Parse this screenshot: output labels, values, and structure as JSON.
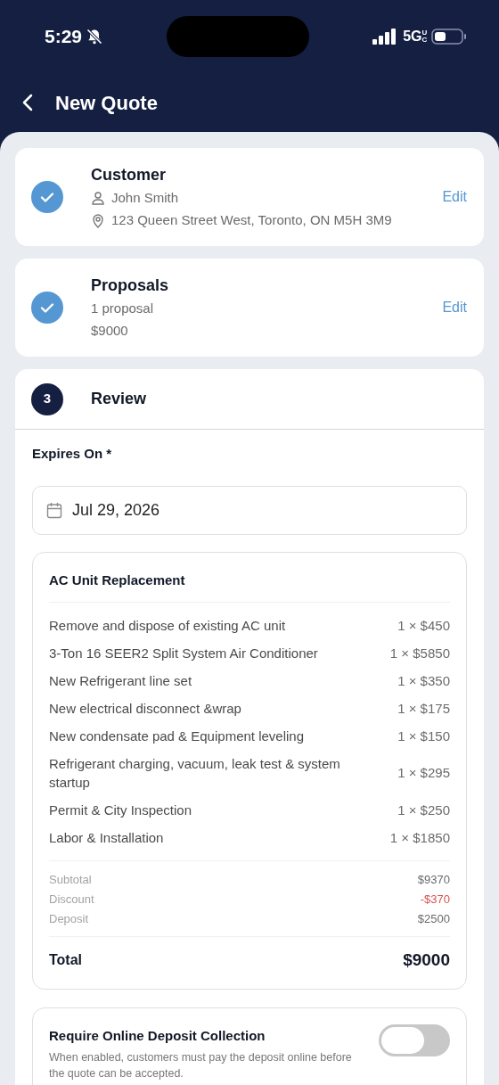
{
  "status_bar": {
    "time": "5:29",
    "network": "5G",
    "network_suffix": "UC"
  },
  "header": {
    "title": "New Quote"
  },
  "steps": [
    {
      "kind": "done",
      "title": "Customer",
      "lines": [
        {
          "kind": "name",
          "text": "John Smith"
        },
        {
          "kind": "address",
          "text": "123 Queen Street West, Toronto, ON M5H 3M9"
        }
      ],
      "action": "Edit"
    },
    {
      "kind": "done",
      "title": "Proposals",
      "lines": [
        {
          "kind": "plain",
          "text": "1 proposal"
        },
        {
          "kind": "plain",
          "text": "$9000"
        }
      ],
      "action": "Edit"
    }
  ],
  "review": {
    "step_number": "3",
    "title": "Review",
    "expires_label": "Expires On *",
    "expires_value": "Jul 29, 2026",
    "proposal": {
      "title": "AC Unit Replacement",
      "items": [
        {
          "description": "Remove and dispose of existing AC unit",
          "amount": "1 × $450"
        },
        {
          "description": "3-Ton 16 SEER2 Split System Air Conditioner",
          "amount": "1 × $5850"
        },
        {
          "description": "New Refrigerant line set",
          "amount": "1 × $350"
        },
        {
          "description": "New electrical disconnect &wrap",
          "amount": "1 × $175"
        },
        {
          "description": "New condensate pad & Equipment leveling",
          "amount": "1 × $150"
        },
        {
          "description": "Refrigerant charging, vacuum, leak test & system startup",
          "amount": "1 × $295"
        },
        {
          "description": "Permit & City Inspection",
          "amount": "1 × $250"
        },
        {
          "description": "Labor & Installation",
          "amount": "1 × $1850"
        }
      ],
      "summary": [
        {
          "kind": "normal",
          "label": "Subtotal",
          "value": "$9370"
        },
        {
          "kind": "negative",
          "label": "Discount",
          "value": "-$370"
        },
        {
          "kind": "normal",
          "label": "Deposit",
          "value": "$2500"
        }
      ],
      "total": {
        "label": "Total",
        "value": "$9000"
      }
    },
    "deposit_toggle": {
      "title": "Require Online Deposit Collection",
      "description": "When enabled, customers must pay the deposit online before the quote can be accepted.",
      "on": false
    }
  }
}
